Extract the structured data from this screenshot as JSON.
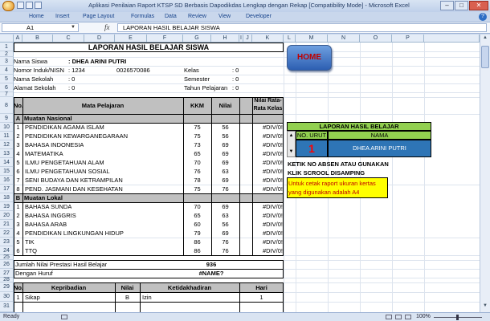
{
  "window": {
    "title": "Aplikasi Penilaian Raport KTSP SD Berbasis Dapodikdas Lengkap dengan Rekap  [Compatibility Mode] - Microsoft Excel",
    "minimize": "–",
    "maximize": "□",
    "close": "✕"
  },
  "ribbon": {
    "tabs": [
      "Home",
      "Insert",
      "Page Layout",
      "Formulas",
      "Data",
      "Review",
      "View",
      "Developer"
    ]
  },
  "formula_bar": {
    "name_box": "A1",
    "fx": "fx",
    "formula": "LAPORAN HASIL BELAJAR SISWA"
  },
  "columns": [
    "A",
    "B",
    "C",
    "D",
    "E",
    "F",
    "G",
    "H",
    "I",
    "J",
    "K",
    "L",
    "M",
    "N",
    "O",
    "P"
  ],
  "rows": [
    "1",
    "2",
    "3",
    "4",
    "5",
    "6",
    "7",
    "8",
    "9",
    "10",
    "11",
    "12",
    "13",
    "14",
    "15",
    "16",
    "17",
    "18",
    "19",
    "20",
    "21",
    "22",
    "23",
    "24",
    "25",
    "26",
    "27",
    "28",
    "29",
    "30",
    "31"
  ],
  "report": {
    "title": "LAPORAN HASIL BELAJAR SISWA",
    "nama_siswa_label": "Nama Siswa",
    "nama_siswa_value": ": DHEA ARINI PUTRI",
    "nomor_label": "Nomor Induk/NISN",
    "nomor_value": ": 1234",
    "nisn": "0026570086",
    "kelas_label": "Kelas",
    "kelas_value": ": 0",
    "sekolah_label": "Nama Sekolah",
    "sekolah_value": ": 0",
    "semester_label": "Semester",
    "semester_value": ": 0",
    "alamat_label": "Alamat Sekolah",
    "alamat_value": ": 0",
    "tahun_label": "Tahun Pelajaran",
    "tahun_value": ": 0",
    "headers": {
      "no": "No.",
      "mapel": "Mata Pelajaran",
      "kkm": "KKM",
      "nilai": "Nilai",
      "rata1": "Nilai Rata-",
      "rata2": "Rata Kelas"
    },
    "groupA": {
      "code": "A",
      "name": "Muatan Nasional"
    },
    "groupB": {
      "code": "B",
      "name": "Muatan Lokal"
    },
    "subjectsA": [
      {
        "no": "1",
        "name": "PENDIDIKAN AGAMA ISLAM",
        "kkm": "75",
        "nilai": "56",
        "rata": "#DIV/0!"
      },
      {
        "no": "2",
        "name": "PENDIDIKAN KEWARGANEGARAAN",
        "kkm": "75",
        "nilai": "56",
        "rata": "#DIV/0!"
      },
      {
        "no": "3",
        "name": "BAHASA INDONESIA",
        "kkm": "73",
        "nilai": "69",
        "rata": "#DIV/0!"
      },
      {
        "no": "4",
        "name": "MATEMATIKA",
        "kkm": "65",
        "nilai": "69",
        "rata": "#DIV/0!"
      },
      {
        "no": "5",
        "name": "ILMU PENGETAHUAN ALAM",
        "kkm": "70",
        "nilai": "69",
        "rata": "#DIV/0!"
      },
      {
        "no": "6",
        "name": "ILMU PENGETAHUAN SOSIAL",
        "kkm": "76",
        "nilai": "63",
        "rata": "#DIV/0!"
      },
      {
        "no": "7",
        "name": "SENI BUDAYA DAN KETRAMPILAN",
        "kkm": "78",
        "nilai": "69",
        "rata": "#DIV/0!"
      },
      {
        "no": "8",
        "name": "PEND. JASMANI DAN KESEHATAN",
        "kkm": "75",
        "nilai": "76",
        "rata": "#DIV/0!"
      }
    ],
    "subjectsB": [
      {
        "no": "1",
        "name": "BAHASA SUNDA",
        "kkm": "70",
        "nilai": "69",
        "rata": "#DIV/0!"
      },
      {
        "no": "2",
        "name": "BAHASA INGGRIS",
        "kkm": "65",
        "nilai": "63",
        "rata": "#DIV/0!"
      },
      {
        "no": "3",
        "name": "BAHASA ARAB",
        "kkm": "60",
        "nilai": "56",
        "rata": "#DIV/0!"
      },
      {
        "no": "4",
        "name": "PENDIDIKAN LINGKUNGAN HIDUP",
        "kkm": "79",
        "nilai": "69",
        "rata": "#DIV/0!"
      },
      {
        "no": "5",
        "name": "TIK",
        "kkm": "86",
        "nilai": "76",
        "rata": "#DIV/0!"
      },
      {
        "no": "6",
        "name": "TTQ",
        "kkm": "86",
        "nilai": "76",
        "rata": "#DIV/0!"
      }
    ],
    "jumlah_label": "Jumlah Nilai Prestasi Hasil Belajar",
    "jumlah_value": "936",
    "huruf_label": "Dengan Huruf",
    "huruf_value": "#NAME?",
    "kep_headers": {
      "no": "No.",
      "kepribadian": "Kepribadian",
      "nilai": "Nilai",
      "ketidakhadiran": "Ketidakhadiran",
      "hari": "Hari"
    },
    "kep_row": {
      "no": "1",
      "aspek": "Sikap",
      "nilai": "B",
      "ket": "Izin",
      "hari": "1"
    }
  },
  "side_panel": {
    "home_button": "HOME",
    "panel_title": "LAPORAN HASIL BELAJAR",
    "no_urut_label": "NO. URUT",
    "nama_label": "NAMA",
    "no_urut_value": "1",
    "nama_value": "DHEA ARINI PUTRI",
    "instruction1": "KETIK NO ABSEN ATAU GUNAKAN",
    "instruction2": "KLIK SCROOL DISAMPING",
    "note1": "Untuk cetak raport ukuran kertas",
    "note2": "yang digunakan adalah A4"
  },
  "status": {
    "ready": "Ready",
    "zoom": "100%"
  }
}
